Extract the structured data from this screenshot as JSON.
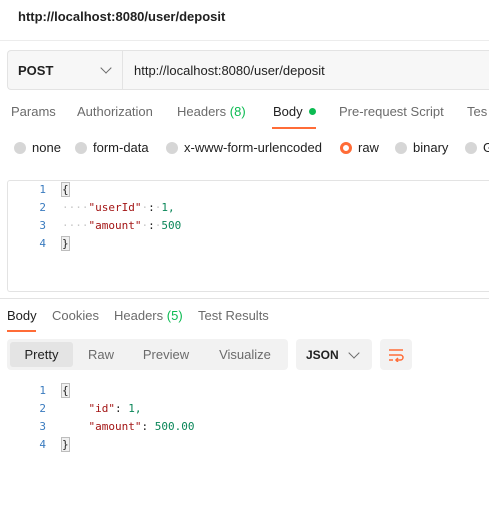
{
  "page": {
    "title": "http://localhost:8080/user/deposit"
  },
  "request": {
    "method": "POST",
    "url": "http://localhost:8080/user/deposit",
    "tabs": [
      {
        "label": "Params"
      },
      {
        "label": "Authorization"
      },
      {
        "label": "Headers",
        "count": "(8)"
      },
      {
        "label": "Body"
      },
      {
        "label": "Pre-request Script"
      },
      {
        "label": "Tes"
      }
    ],
    "body_types": [
      "none",
      "form-data",
      "x-www-form-urlencoded",
      "raw",
      "binary",
      "G"
    ],
    "selected_body_type": "raw",
    "body_lines": [
      {
        "n": "1",
        "brace": "{"
      },
      {
        "n": "2",
        "key": "\"userId\"",
        "val": "1,"
      },
      {
        "n": "3",
        "key": "\"amount\"",
        "val": "500"
      },
      {
        "n": "4",
        "brace": "}"
      }
    ]
  },
  "response": {
    "tabs": [
      {
        "label": "Body"
      },
      {
        "label": "Cookies"
      },
      {
        "label": "Headers",
        "count": "(5)"
      },
      {
        "label": "Test Results"
      }
    ],
    "view_modes": [
      "Pretty",
      "Raw",
      "Preview",
      "Visualize"
    ],
    "active_view": "Pretty",
    "format": "JSON",
    "body_lines": [
      {
        "n": "1",
        "brace": "{"
      },
      {
        "n": "2",
        "key": "\"id\"",
        "val": "1,"
      },
      {
        "n": "3",
        "key": "\"amount\"",
        "val": "500.00"
      },
      {
        "n": "4",
        "brace": "}"
      }
    ]
  },
  "colors": {
    "accent": "#ff6c37",
    "count_green": "#0cbb52",
    "json_key": "#a31515",
    "json_number": "#098658"
  },
  "icons": {
    "method_dropdown": "chevron-down-icon",
    "format_dropdown": "chevron-down-icon",
    "wrap": "wrap-lines-icon"
  }
}
